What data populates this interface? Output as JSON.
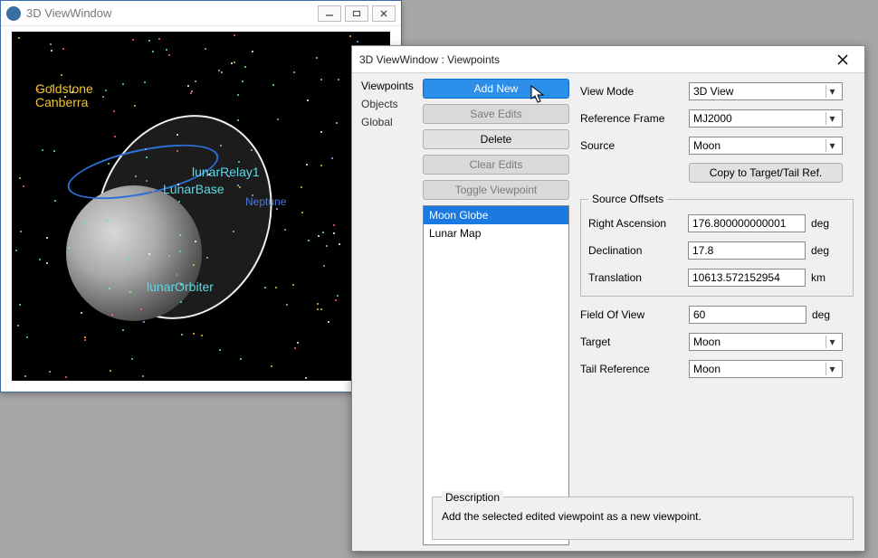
{
  "win3d": {
    "title": "3D ViewWindow",
    "labels": {
      "goldstone": "Goldstone",
      "canberra": "Canberra",
      "lunarRelay1": "lunarRelay1",
      "lunarBase": "LunarBase",
      "neptune": "Neptune",
      "lunarOrbiter": "lunarOrbiter"
    }
  },
  "dialog": {
    "title": "3D ViewWindow : Viewpoints",
    "tabs": [
      "Viewpoints",
      "Objects",
      "Global"
    ],
    "activeTab": "Viewpoints",
    "buttons": {
      "addNew": "Add New",
      "saveEdits": "Save Edits",
      "delete": "Delete",
      "clearEdits": "Clear Edits",
      "toggleViewpoint": "Toggle Viewpoint",
      "copyTarget": "Copy to Target/Tail Ref."
    },
    "listItems": [
      "Moon Globe",
      "Lunar Map"
    ],
    "listSelected": "Moon Globe",
    "fields": {
      "viewMode": {
        "label": "View Mode",
        "value": "3D View"
      },
      "referenceFrame": {
        "label": "Reference Frame",
        "value": "MJ2000"
      },
      "source": {
        "label": "Source",
        "value": "Moon"
      },
      "fieldOfView": {
        "label": "Field Of View",
        "value": "60",
        "unit": "deg"
      },
      "target": {
        "label": "Target",
        "value": "Moon"
      },
      "tailReference": {
        "label": "Tail Reference",
        "value": "Moon"
      }
    },
    "sourceOffsets": {
      "legend": "Source Offsets",
      "rightAscension": {
        "label": "Right Ascension",
        "value": "176.800000000001",
        "unit": "deg"
      },
      "declination": {
        "label": "Declination",
        "value": "17.8",
        "unit": "deg"
      },
      "translation": {
        "label": "Translation",
        "value": "10613.572152954",
        "unit": "km"
      }
    },
    "description": {
      "legend": "Description",
      "text": "Add the selected edited viewpoint as a new viewpoint."
    }
  }
}
